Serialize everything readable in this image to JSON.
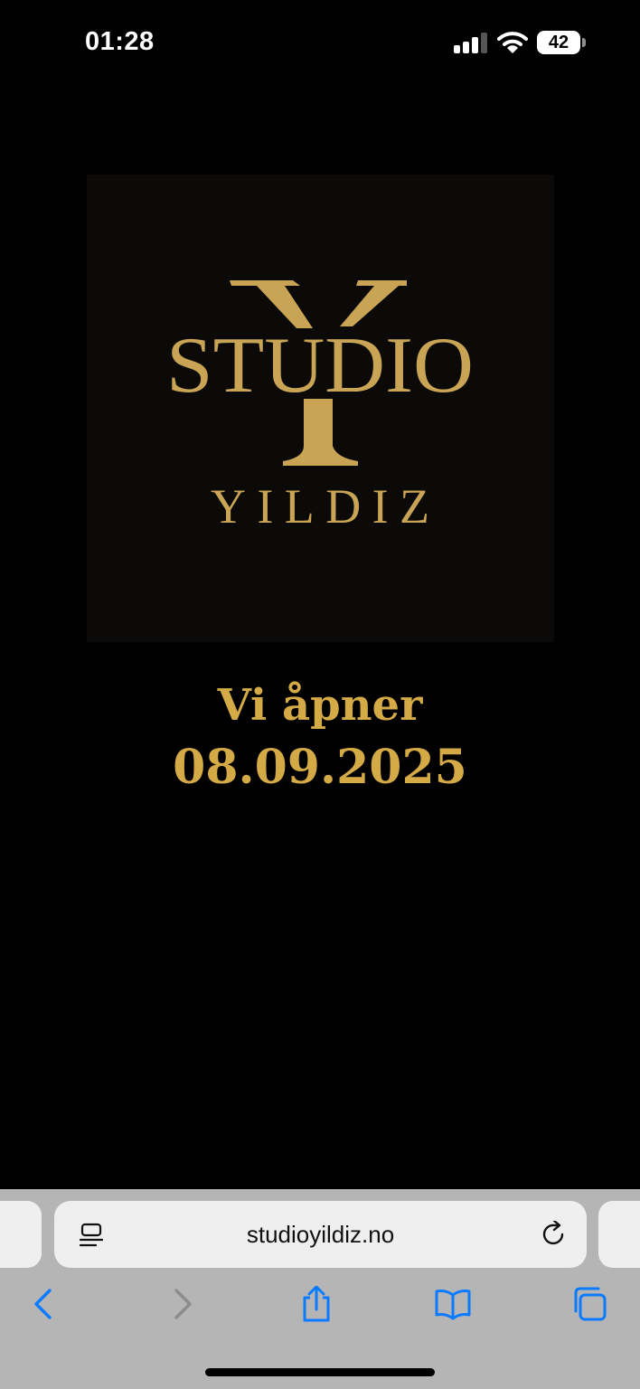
{
  "status_bar": {
    "time": "01:28",
    "battery_level": "42",
    "icons": [
      "signal-icon",
      "wifi-icon",
      "battery-icon"
    ]
  },
  "logo": {
    "word": "STUDIO",
    "name": "YILDIZ",
    "color": "#c9a455",
    "background": "#0b0a08"
  },
  "opening": {
    "line1": "Vi åpner",
    "line2": "08.09.2025",
    "color": "#d4aa46"
  },
  "browser": {
    "url": "studioyildiz.no",
    "icons": [
      "reader-icon",
      "reload-icon",
      "back-icon",
      "forward-icon",
      "share-icon",
      "bookmarks-icon",
      "tabs-icon"
    ],
    "accent": "#0a7aff"
  }
}
